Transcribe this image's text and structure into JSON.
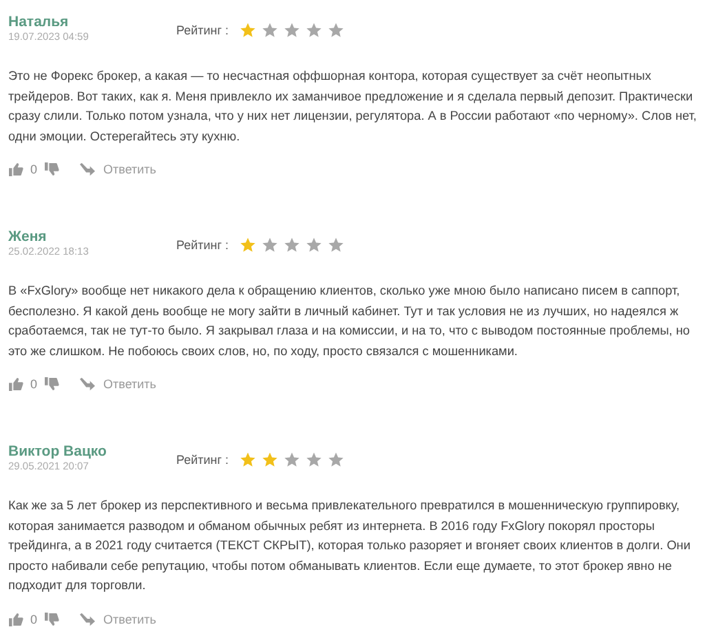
{
  "reviews": [
    {
      "author": "Наталья",
      "date": "19.07.2023 04:59",
      "rating_label": "Рейтинг :",
      "stars": 1,
      "text": "Это не Форекс брокер, а какая — то несчастная оффшорная контора, которая существует за счёт неопытных трейдеров. Вот таких, как я. Меня привлекло их заманчивое предложение и я сделала первый депозит. Практически сразу слили. Только потом узнала, что у них нет лицензии, регулятора. А в России работают «по черному». Слов нет, одни эмоции. Остерегайтесь эту кухню.",
      "likes": "0",
      "reply": "Ответить"
    },
    {
      "author": "Женя",
      "date": "25.02.2022 18:13",
      "rating_label": "Рейтинг :",
      "stars": 1,
      "text": "В «FxGlory» вообще нет никакого дела к обращению клиентов, сколько уже мною было написано писем в саппорт, бесполезно. Я какой день вообще не могу зайти в личный кабинет. Тут и так условия не из лучших, но надеялся ж сработаемся, так не тут-то было. Я закрывал глаза и на комиссии, и на то, что с выводом постоянные проблемы, но это же слишком. Не побоюсь своих слов, но, по ходу, просто связался с мошенниками.",
      "likes": "0",
      "reply": "Ответить"
    },
    {
      "author": "Виктор Вацко",
      "date": "29.05.2021 20:07",
      "rating_label": "Рейтинг :",
      "stars": 2,
      "text": "Как же за 5 лет брокер из перспективного и весьма привлекательного превратился в мошенническую группировку, которая занимается разводом и обманом обычных ребят из интернета. В 2016 году FxGlory покорял просторы трейдинга, а в 2021 году считается (ТЕКСТ СКРЫТ), которая только разоряет и вгоняет своих клиентов в долги. Они просто набивали себе репутацию, чтобы потом обманывать клиентов. Если еще думаете, то этот брокер явно не подходит для торговли.",
      "likes": "0",
      "reply": "Ответить"
    }
  ]
}
